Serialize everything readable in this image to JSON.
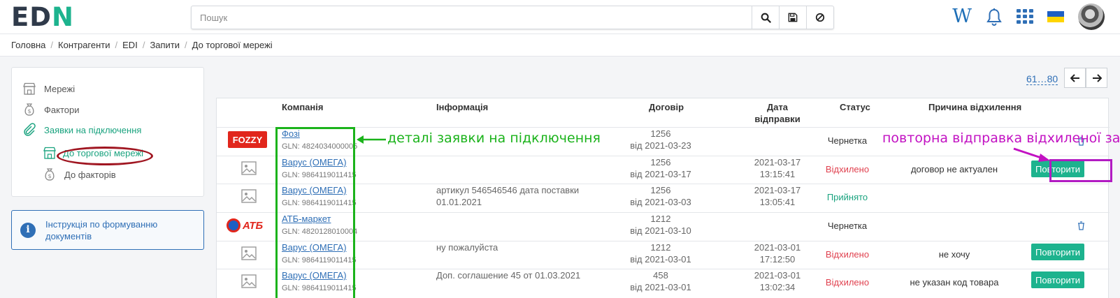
{
  "header": {
    "logo_left": "ED",
    "logo_right": "N",
    "search_placeholder": "Пошук",
    "icons": [
      "search-icon",
      "save-icon",
      "ban-icon",
      "wiki-icon",
      "bell-icon",
      "apps-grid-icon",
      "flag-ukraine-icon",
      "avatar"
    ],
    "wiki_label": "W"
  },
  "breadcrumb": [
    "Головна",
    "Контрагенти",
    "EDI",
    "Запити",
    "До торгової мережі"
  ],
  "sidebar": {
    "items": [
      {
        "label": "Мережі",
        "icon": "store-icon"
      },
      {
        "label": "Фактори",
        "icon": "money-bag-icon"
      },
      {
        "label": "Заявки на підключення",
        "icon": "paperclip-icon"
      },
      {
        "label": "До торгової мережі",
        "icon": "store-icon"
      },
      {
        "label": "До факторів",
        "icon": "money-bag-icon"
      }
    ],
    "info": "Інструкція по формуванню документів"
  },
  "pager": {
    "range": "61…80"
  },
  "table": {
    "headers": {
      "company": "Компанія",
      "info": "Інформація",
      "contract": "Договір",
      "date_line1": "Дата",
      "date_line2": "відправки",
      "status": "Статус",
      "reason": "Причина відхилення"
    },
    "rows": [
      {
        "logo": "fozzy",
        "logo_text": "FOZZY",
        "company": "Фозі",
        "gln": "GLN: 4824034000005",
        "info": "",
        "info2": "",
        "contract_no": "1256",
        "contract_date": "від 2021-03-23",
        "sent_date": "",
        "sent_time": "",
        "status": "Чернетка",
        "status_type": "draft",
        "reason": "",
        "action": "delete"
      },
      {
        "logo": "placeholder",
        "logo_text": "",
        "company": "Варус (ОМЕГА)",
        "gln": "GLN: 9864119011415",
        "info": "",
        "info2": "",
        "contract_no": "1256",
        "contract_date": "від 2021-03-17",
        "sent_date": "2021-03-17",
        "sent_time": "13:15:41",
        "status": "Відхилено",
        "status_type": "rejected",
        "reason": "договор не актуален",
        "action": "repeat"
      },
      {
        "logo": "placeholder",
        "logo_text": "",
        "company": "Варус (ОМЕГА)",
        "gln": "GLN: 9864119011415",
        "info": "артикул 546546546 дата поставки",
        "info2": "01.01.2021",
        "contract_no": "1256",
        "contract_date": "від 2021-03-03",
        "sent_date": "2021-03-17",
        "sent_time": "13:05:41",
        "status": "Прийнято",
        "status_type": "accepted",
        "reason": "",
        "action": ""
      },
      {
        "logo": "atb",
        "logo_text": "АТБ",
        "company": "АТБ-маркет",
        "gln": "GLN: 4820128010004",
        "info": "",
        "info2": "",
        "contract_no": "1212",
        "contract_date": "від 2021-03-10",
        "sent_date": "",
        "sent_time": "",
        "status": "Чернетка",
        "status_type": "draft",
        "reason": "",
        "action": "delete"
      },
      {
        "logo": "placeholder",
        "logo_text": "",
        "company": "Варус (ОМЕГА)",
        "gln": "GLN: 9864119011415",
        "info": "ну пожалуйста",
        "info2": "",
        "contract_no": "1212",
        "contract_date": "від 2021-03-01",
        "sent_date": "2021-03-01",
        "sent_time": "17:12:50",
        "status": "Відхилено",
        "status_type": "rejected",
        "reason": "не хочу",
        "action": "repeat"
      },
      {
        "logo": "placeholder",
        "logo_text": "",
        "company": "Варус (ОМЕГА)",
        "gln": "GLN: 9864119011415",
        "info": "Доп. соглашение 45 от 01.03.2021",
        "info2": "",
        "contract_no": "458",
        "contract_date": "від 2021-03-01",
        "sent_date": "2021-03-01",
        "sent_time": "13:02:34",
        "status": "Відхилено",
        "status_type": "rejected",
        "reason": "не указан код товара",
        "action": "repeat"
      }
    ],
    "repeat_label": "Повторити"
  },
  "annotations": {
    "details": "деталі заявки на підключення",
    "resend": "повторна відправка відхиленої заявки"
  },
  "colors": {
    "accent": "#1db38e",
    "link": "#2f6fb6",
    "rejected": "#e0414f",
    "annotation_green": "#1bb31b",
    "annotation_magenta": "#c211c2",
    "annotation_ellipse": "#a01621"
  }
}
